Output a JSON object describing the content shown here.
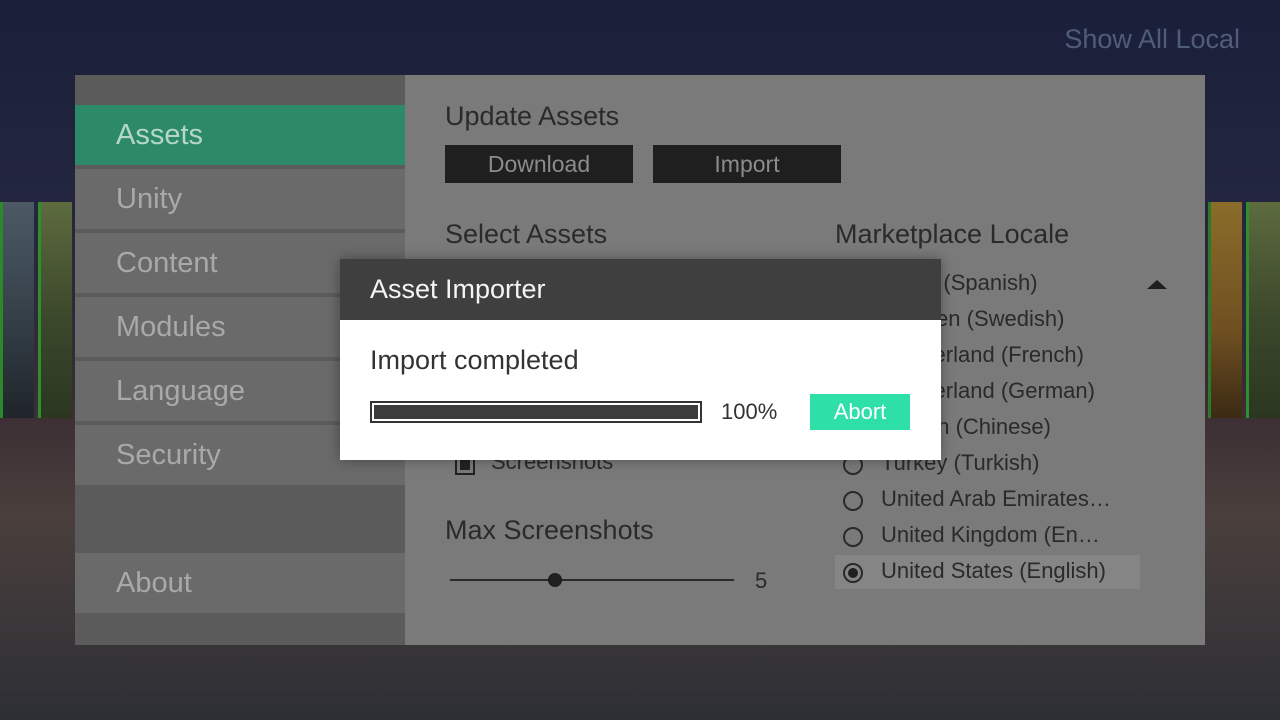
{
  "top_right": {
    "show_all_local": "Show All Local"
  },
  "sidebar": {
    "items": [
      {
        "label": "Assets"
      },
      {
        "label": "Unity"
      },
      {
        "label": "Content"
      },
      {
        "label": "Modules"
      },
      {
        "label": "Language"
      },
      {
        "label": "Security"
      }
    ],
    "about": {
      "label": "About"
    }
  },
  "main": {
    "update_assets_title": "Update Assets",
    "download_label": "Download",
    "import_label": "Import",
    "select_assets_title": "Select Assets",
    "screenshots_label": "Screenshots",
    "screenshots_checked": true,
    "max_screenshots_title": "Max Screenshots",
    "max_screenshots_value": "5",
    "marketplace_locale_title": "Marketplace Locale",
    "locales": [
      {
        "label": "Spain (Spanish)",
        "selected": false
      },
      {
        "label": "Sweden (Swedish)",
        "selected": false
      },
      {
        "label": "Switzerland (French)",
        "selected": false
      },
      {
        "label": "Switzerland (German)",
        "selected": false
      },
      {
        "label": "Taiwan (Chinese)",
        "selected": false
      },
      {
        "label": "Turkey (Turkish)",
        "selected": false
      },
      {
        "label": "United Arab Emirates…",
        "selected": false
      },
      {
        "label": "United Kingdom (En…",
        "selected": false
      },
      {
        "label": "United States (English)",
        "selected": true
      }
    ]
  },
  "dialog": {
    "title": "Asset Importer",
    "message": "Import completed",
    "progress_percent": 100,
    "progress_text": "100%",
    "abort_label": "Abort"
  },
  "colors": {
    "accent_green": "#2d8a68",
    "abort_button": "#2ee0a8",
    "dialog_header": "#3f3f3f"
  }
}
